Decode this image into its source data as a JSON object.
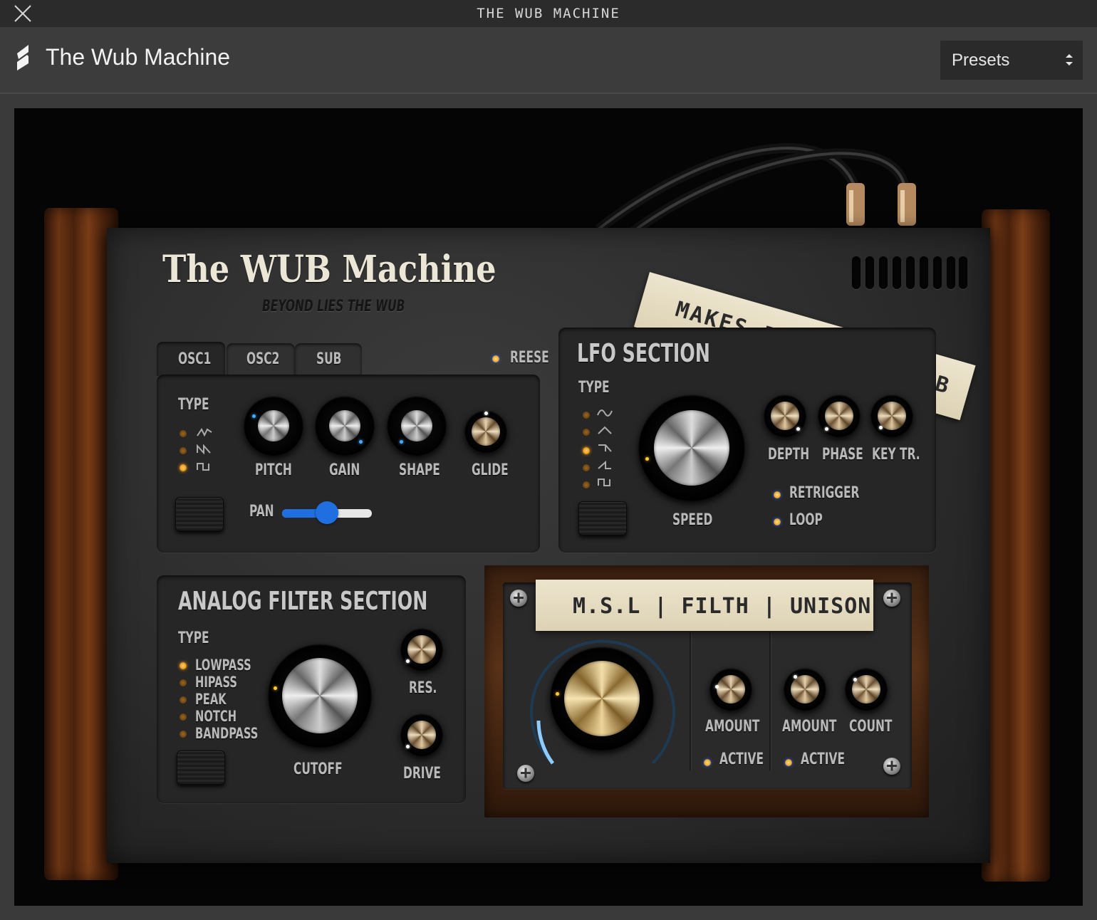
{
  "window": {
    "title": "THE WUB MACHINE"
  },
  "header": {
    "app_title": "The Wub Machine",
    "presets_label": "Presets"
  },
  "plugin": {
    "logo": {
      "title": "The WUB Machine",
      "tagline": "BEYOND LIES THE WUB"
    },
    "tape_top": "MAKES IT GO WUB WUB",
    "osc": {
      "tabs": [
        "OSC1",
        "OSC2",
        "SUB"
      ],
      "reese_label": "REESE",
      "type_label": "TYPE",
      "knobs": [
        "PITCH",
        "GAIN",
        "SHAPE",
        "GLIDE"
      ],
      "pan_label": "PAN",
      "pan_value": 0.5
    },
    "lfo": {
      "title": "LFO SECTION",
      "type_label": "TYPE",
      "speed_label": "SPEED",
      "knobs": [
        "DEPTH",
        "PHASE",
        "KEY TR."
      ],
      "retrigger_label": "RETRIGGER",
      "loop_label": "LOOP"
    },
    "filter": {
      "title": "ANALOG FILTER SECTION",
      "type_label": "TYPE",
      "types": [
        "LOWPASS",
        "HIPASS",
        "PEAK",
        "NOTCH",
        "BANDPASS"
      ],
      "cutoff_label": "CUTOFF",
      "res_label": "RES.",
      "drive_label": "DRIVE"
    },
    "msl": {
      "tape": "M.S.L | FILTH | UNISON",
      "filth_amount_label": "AMOUNT",
      "filth_active_label": "ACTIVE",
      "unison_amount_label": "AMOUNT",
      "unison_count_label": "COUNT",
      "unison_active_label": "ACTIVE"
    }
  }
}
